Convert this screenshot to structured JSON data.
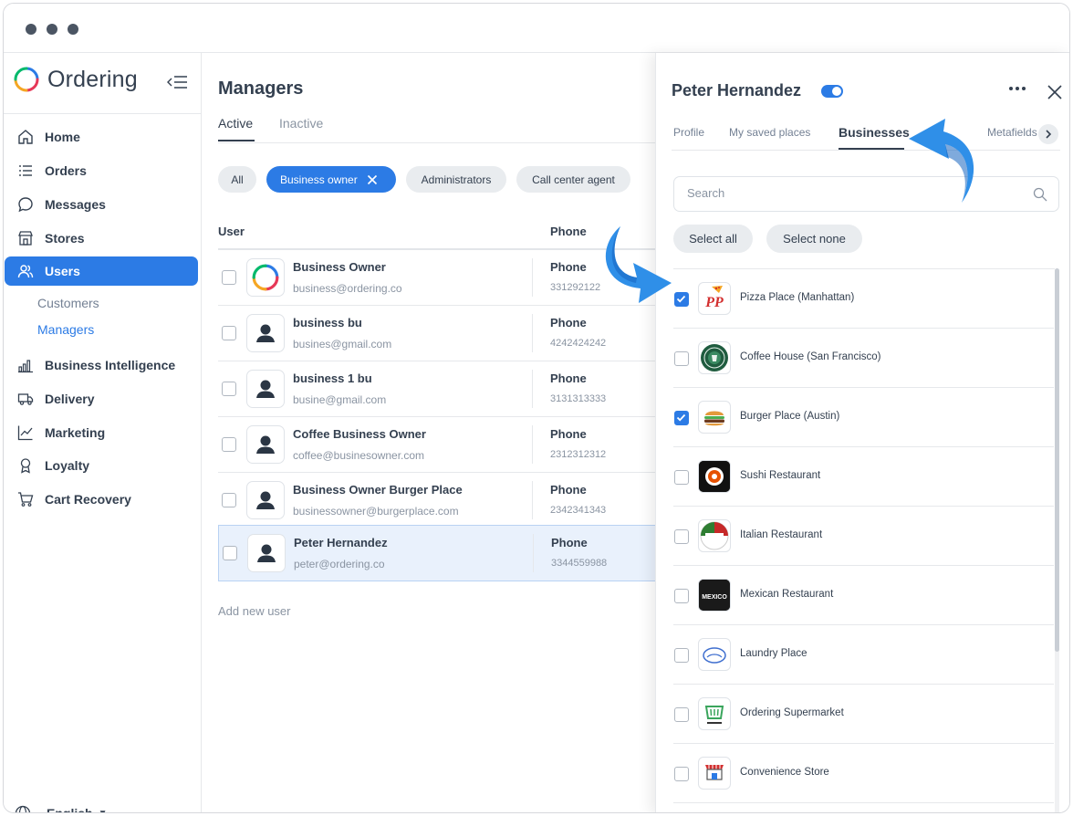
{
  "app": {
    "logo_text": "Ordering"
  },
  "sidebar": {
    "items": [
      {
        "label": "Home",
        "icon": "home-icon"
      },
      {
        "label": "Orders",
        "icon": "list-icon"
      },
      {
        "label": "Messages",
        "icon": "chat-icon"
      },
      {
        "label": "Stores",
        "icon": "store-icon"
      },
      {
        "label": "Users",
        "icon": "users-icon",
        "active": true
      },
      {
        "label": "Business Intelligence",
        "icon": "bar-chart-icon"
      },
      {
        "label": "Delivery",
        "icon": "truck-icon"
      },
      {
        "label": "Marketing",
        "icon": "trend-icon"
      },
      {
        "label": "Loyalty",
        "icon": "award-icon"
      },
      {
        "label": "Cart Recovery",
        "icon": "cart-icon"
      }
    ],
    "subitems": [
      {
        "label": "Customers"
      },
      {
        "label": "Managers",
        "active": true
      }
    ],
    "language": "English"
  },
  "main": {
    "title": "Managers",
    "tabs": [
      {
        "label": "Active",
        "active": true
      },
      {
        "label": "Inactive"
      }
    ],
    "chips": [
      {
        "label": "All"
      },
      {
        "label": "Business owner",
        "active": true
      },
      {
        "label": "Administrators"
      },
      {
        "label": "Call center agent"
      }
    ],
    "columns": {
      "user": "User",
      "phone": "Phone"
    },
    "rows": [
      {
        "name": "Business Owner",
        "email": "business@ordering.co",
        "phone_label": "Phone",
        "phone": "331292122"
      },
      {
        "name": "business bu",
        "email": "busines@gmail.com",
        "phone_label": "Phone",
        "phone": "4242424242"
      },
      {
        "name": "business 1 bu",
        "email": "busine@gmail.com",
        "phone_label": "Phone",
        "phone": "3131313333"
      },
      {
        "name": "Coffee Business Owner",
        "email": "coffee@businesowner.com",
        "phone_label": "Phone",
        "phone": "2312312312"
      },
      {
        "name": "Business Owner Burger Place",
        "email": "businessowner@burgerplace.com",
        "phone_label": "Phone",
        "phone": "2342341343"
      },
      {
        "name": "Peter Hernandez",
        "email": "peter@ordering.co",
        "phone_label": "Phone",
        "phone": "3344559988",
        "selected": true
      }
    ],
    "add_user": "Add new user"
  },
  "panel": {
    "title": "Peter Hernandez",
    "tabs": [
      {
        "label": "Profile"
      },
      {
        "label": "My saved places"
      },
      {
        "label": "Businesses",
        "active": true
      },
      {
        "label": "Metafields"
      }
    ],
    "search_placeholder": "Search",
    "select_all": "Select all",
    "select_none": "Select none",
    "businesses": [
      {
        "name": "Pizza Place (Manhattan)",
        "checked": true,
        "logo_text": "PP"
      },
      {
        "name": "Coffee House (San Francisco)",
        "checked": false
      },
      {
        "name": "Burger Place (Austin)",
        "checked": true
      },
      {
        "name": "Sushi Restaurant",
        "checked": false
      },
      {
        "name": "Italian Restaurant",
        "checked": false
      },
      {
        "name": "Mexican Restaurant",
        "checked": false,
        "logo_text": "MEXICO"
      },
      {
        "name": "Laundry Place",
        "checked": false
      },
      {
        "name": "Ordering Supermarket",
        "checked": false
      },
      {
        "name": "Convenience Store",
        "checked": false
      }
    ]
  },
  "colors": {
    "accent": "#2C7BE5",
    "text": "#344050",
    "muted": "#8A94A2",
    "arrow": "#2F8FE8"
  }
}
